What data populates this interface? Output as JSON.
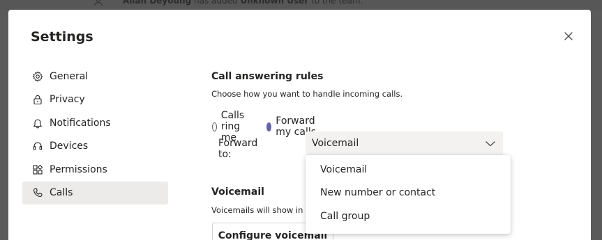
{
  "background": {
    "notification_user": "Allan Deyoung",
    "notification_text": " has added ",
    "notification_target": "Unknown User",
    "notification_tail": " to the team."
  },
  "dialog": {
    "title": "Settings",
    "close_icon": "close-icon"
  },
  "sidebar": {
    "items": [
      {
        "label": "General",
        "icon": "gear-icon"
      },
      {
        "label": "Privacy",
        "icon": "lock-icon"
      },
      {
        "label": "Notifications",
        "icon": "bell-icon"
      },
      {
        "label": "Devices",
        "icon": "headset-icon"
      },
      {
        "label": "Permissions",
        "icon": "grid-icon"
      },
      {
        "label": "Calls",
        "icon": "phone-icon",
        "active": true
      }
    ]
  },
  "call_rules": {
    "heading": "Call answering rules",
    "description": "Choose how you want to handle incoming calls.",
    "options": [
      {
        "label": "Calls ring me",
        "selected": false
      },
      {
        "label": "Forward my calls",
        "selected": true
      }
    ],
    "forward_label": "Forward to:",
    "forward_value": "Voicemail",
    "dropdown_options": [
      "Voicemail",
      "New number or contact",
      "Call group"
    ]
  },
  "voicemail": {
    "heading": "Voicemail",
    "description": "Voicemails will show in th",
    "configure_label": "Configure voicemail"
  },
  "colors": {
    "accent": "#6264a7",
    "active_nav": "#edebe9",
    "select_bg": "#f3f2f1"
  }
}
